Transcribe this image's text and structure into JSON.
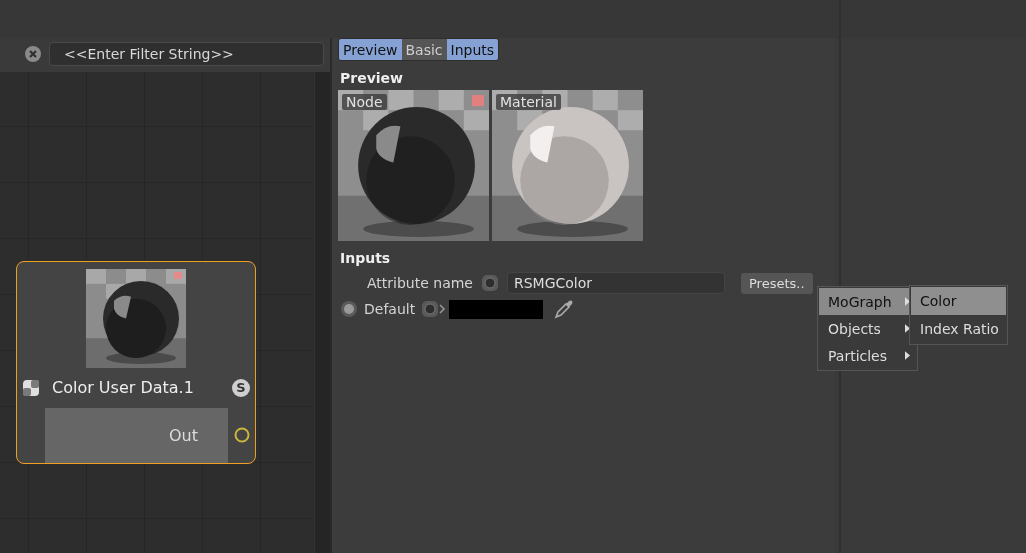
{
  "filter": {
    "placeholder": "<<Enter Filter String>>"
  },
  "node": {
    "title": "Color User Data.1",
    "selected": true,
    "port_badge": "S",
    "outputs": [
      "Out"
    ]
  },
  "tabs": [
    {
      "label": "Preview",
      "selected": true
    },
    {
      "label": "Basic",
      "selected": false
    },
    {
      "label": "Inputs",
      "selected": true
    }
  ],
  "preview": {
    "heading": "Preview",
    "images": [
      {
        "label": "Node"
      },
      {
        "label": "Material"
      }
    ]
  },
  "inputs": {
    "heading": "Inputs",
    "attribute_label": "Attribute name",
    "attribute_value": "RSMGColor",
    "presets_button": "Presets..",
    "default_label": "Default"
  },
  "menu": {
    "items": [
      {
        "label": "MoGraph",
        "selected": true,
        "submenu": true
      },
      {
        "label": "Objects",
        "selected": false,
        "submenu": true
      },
      {
        "label": "Particles",
        "selected": false,
        "submenu": true
      }
    ],
    "submenu": [
      {
        "label": "Color",
        "selected": true
      },
      {
        "label": "Index Ratio",
        "selected": false
      }
    ]
  }
}
